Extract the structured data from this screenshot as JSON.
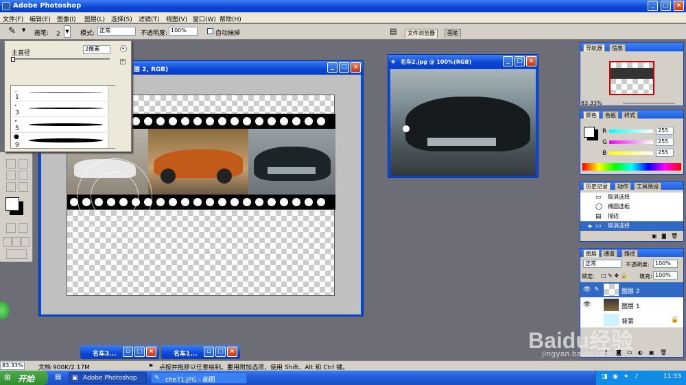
{
  "app": {
    "title": "Adobe Photoshop"
  },
  "menu": [
    "文件(F)",
    "编辑(E)",
    "图像(I)",
    "图层(L)",
    "选择(S)",
    "滤镜(T)",
    "视图(V)",
    "窗口(W)",
    "帮助(H)"
  ],
  "options": {
    "brush_label": "画笔:",
    "brush_size": "2",
    "mode_label": "模式:",
    "mode_value": "正常",
    "opacity_label": "不透明度:",
    "opacity_value": "100%",
    "auto_erase": "自动抹掉",
    "tab_file_browser": "文件浏览器",
    "tab_brush": "画笔"
  },
  "brush_popup": {
    "diameter_label": "主直径",
    "diameter_value": "2像素",
    "sizes": [
      "1",
      "3",
      "5",
      "9"
    ]
  },
  "doc_main": {
    "title": "层 2, RGB)"
  },
  "doc_car2": {
    "title": "名车2.jpg @ 100%(RGB)"
  },
  "minimized": [
    "名车3...",
    "名车1..."
  ],
  "navigator": {
    "tabs": [
      "导航器",
      "信息"
    ],
    "zoom": "83.33%"
  },
  "color": {
    "tabs": [
      "颜色",
      "色板",
      "样式"
    ],
    "r_label": "R",
    "g_label": "G",
    "b_label": "B",
    "r": "255",
    "g": "255",
    "b": "255"
  },
  "history": {
    "tabs": [
      "历史记录",
      "动作",
      "工具预设"
    ],
    "items": [
      "取消选择",
      "椭圆选框",
      "描边",
      "取消选择"
    ]
  },
  "layers": {
    "tabs": [
      "图层",
      "通道",
      "路径"
    ],
    "blend": "正常",
    "opacity_label": "不透明度:",
    "opacity": "100%",
    "lock_label": "锁定:",
    "fill_label": "填充:",
    "fill": "100%",
    "items": [
      "图层 2",
      "图层 1",
      "背景"
    ]
  },
  "status": {
    "zoom": "83.33%",
    "doc": "文档:900K/2.17M",
    "hint": "点按并拖移以任意绘制。要用附加选项，使用 Shift、Alt 和 Ctrl 键。"
  },
  "taskbar": {
    "start": "开始",
    "tasks": [
      "Adobe Photoshop",
      "che71.JPG - 画图"
    ],
    "time": "11:33"
  },
  "watermark": {
    "text": "Baidu经验",
    "url": "jingyan.baidu.com"
  }
}
